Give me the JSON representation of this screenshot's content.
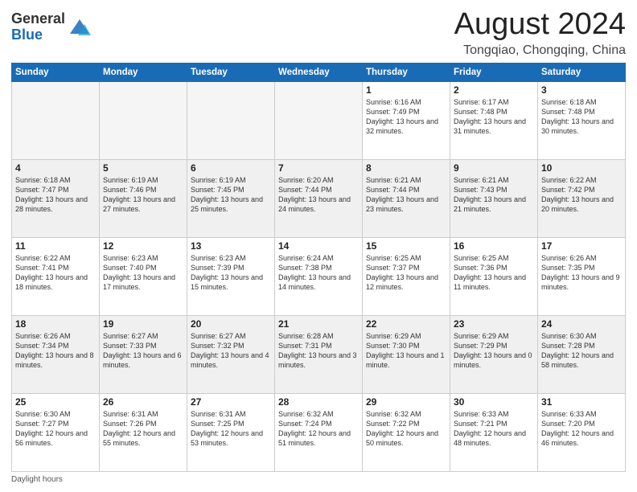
{
  "logo": {
    "general": "General",
    "blue": "Blue"
  },
  "title": "August 2024",
  "location": "Tongqiao, Chongqing, China",
  "days_of_week": [
    "Sunday",
    "Monday",
    "Tuesday",
    "Wednesday",
    "Thursday",
    "Friday",
    "Saturday"
  ],
  "weeks": [
    [
      {
        "day": "",
        "info": ""
      },
      {
        "day": "",
        "info": ""
      },
      {
        "day": "",
        "info": ""
      },
      {
        "day": "",
        "info": ""
      },
      {
        "day": "1",
        "info": "Sunrise: 6:16 AM\nSunset: 7:49 PM\nDaylight: 13 hours and 32 minutes."
      },
      {
        "day": "2",
        "info": "Sunrise: 6:17 AM\nSunset: 7:48 PM\nDaylight: 13 hours and 31 minutes."
      },
      {
        "day": "3",
        "info": "Sunrise: 6:18 AM\nSunset: 7:48 PM\nDaylight: 13 hours and 30 minutes."
      }
    ],
    [
      {
        "day": "4",
        "info": "Sunrise: 6:18 AM\nSunset: 7:47 PM\nDaylight: 13 hours and 28 minutes."
      },
      {
        "day": "5",
        "info": "Sunrise: 6:19 AM\nSunset: 7:46 PM\nDaylight: 13 hours and 27 minutes."
      },
      {
        "day": "6",
        "info": "Sunrise: 6:19 AM\nSunset: 7:45 PM\nDaylight: 13 hours and 25 minutes."
      },
      {
        "day": "7",
        "info": "Sunrise: 6:20 AM\nSunset: 7:44 PM\nDaylight: 13 hours and 24 minutes."
      },
      {
        "day": "8",
        "info": "Sunrise: 6:21 AM\nSunset: 7:44 PM\nDaylight: 13 hours and 23 minutes."
      },
      {
        "day": "9",
        "info": "Sunrise: 6:21 AM\nSunset: 7:43 PM\nDaylight: 13 hours and 21 minutes."
      },
      {
        "day": "10",
        "info": "Sunrise: 6:22 AM\nSunset: 7:42 PM\nDaylight: 13 hours and 20 minutes."
      }
    ],
    [
      {
        "day": "11",
        "info": "Sunrise: 6:22 AM\nSunset: 7:41 PM\nDaylight: 13 hours and 18 minutes."
      },
      {
        "day": "12",
        "info": "Sunrise: 6:23 AM\nSunset: 7:40 PM\nDaylight: 13 hours and 17 minutes."
      },
      {
        "day": "13",
        "info": "Sunrise: 6:23 AM\nSunset: 7:39 PM\nDaylight: 13 hours and 15 minutes."
      },
      {
        "day": "14",
        "info": "Sunrise: 6:24 AM\nSunset: 7:38 PM\nDaylight: 13 hours and 14 minutes."
      },
      {
        "day": "15",
        "info": "Sunrise: 6:25 AM\nSunset: 7:37 PM\nDaylight: 13 hours and 12 minutes."
      },
      {
        "day": "16",
        "info": "Sunrise: 6:25 AM\nSunset: 7:36 PM\nDaylight: 13 hours and 11 minutes."
      },
      {
        "day": "17",
        "info": "Sunrise: 6:26 AM\nSunset: 7:35 PM\nDaylight: 13 hours and 9 minutes."
      }
    ],
    [
      {
        "day": "18",
        "info": "Sunrise: 6:26 AM\nSunset: 7:34 PM\nDaylight: 13 hours and 8 minutes."
      },
      {
        "day": "19",
        "info": "Sunrise: 6:27 AM\nSunset: 7:33 PM\nDaylight: 13 hours and 6 minutes."
      },
      {
        "day": "20",
        "info": "Sunrise: 6:27 AM\nSunset: 7:32 PM\nDaylight: 13 hours and 4 minutes."
      },
      {
        "day": "21",
        "info": "Sunrise: 6:28 AM\nSunset: 7:31 PM\nDaylight: 13 hours and 3 minutes."
      },
      {
        "day": "22",
        "info": "Sunrise: 6:29 AM\nSunset: 7:30 PM\nDaylight: 13 hours and 1 minute."
      },
      {
        "day": "23",
        "info": "Sunrise: 6:29 AM\nSunset: 7:29 PM\nDaylight: 13 hours and 0 minutes."
      },
      {
        "day": "24",
        "info": "Sunrise: 6:30 AM\nSunset: 7:28 PM\nDaylight: 12 hours and 58 minutes."
      }
    ],
    [
      {
        "day": "25",
        "info": "Sunrise: 6:30 AM\nSunset: 7:27 PM\nDaylight: 12 hours and 56 minutes."
      },
      {
        "day": "26",
        "info": "Sunrise: 6:31 AM\nSunset: 7:26 PM\nDaylight: 12 hours and 55 minutes."
      },
      {
        "day": "27",
        "info": "Sunrise: 6:31 AM\nSunset: 7:25 PM\nDaylight: 12 hours and 53 minutes."
      },
      {
        "day": "28",
        "info": "Sunrise: 6:32 AM\nSunset: 7:24 PM\nDaylight: 12 hours and 51 minutes."
      },
      {
        "day": "29",
        "info": "Sunrise: 6:32 AM\nSunset: 7:22 PM\nDaylight: 12 hours and 50 minutes."
      },
      {
        "day": "30",
        "info": "Sunrise: 6:33 AM\nSunset: 7:21 PM\nDaylight: 12 hours and 48 minutes."
      },
      {
        "day": "31",
        "info": "Sunrise: 6:33 AM\nSunset: 7:20 PM\nDaylight: 12 hours and 46 minutes."
      }
    ]
  ],
  "footer": "Daylight hours"
}
